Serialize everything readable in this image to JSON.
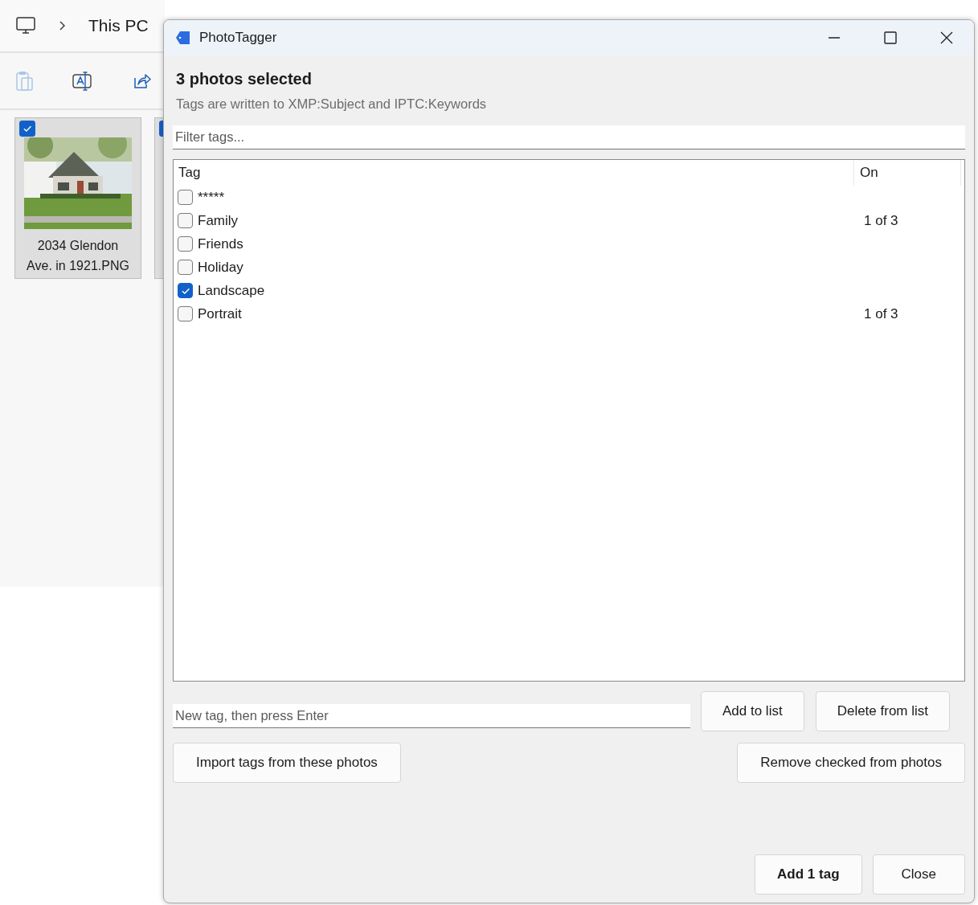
{
  "explorer": {
    "breadcrumb": [
      {
        "label": "This PC"
      }
    ],
    "files": [
      {
        "name": "2034 Glendon Ave. in 1921.PNG",
        "selected": true,
        "kind": "picture"
      },
      {
        "selected": true
      }
    ]
  },
  "dialog": {
    "title": "PhotoTagger",
    "heading": "3 photos selected",
    "subtitle": "Tags are written to XMP:Subject and IPTC:Keywords",
    "filter": {
      "placeholder": "Filter tags..."
    },
    "tag_list": {
      "columns": [
        "Tag",
        "On"
      ],
      "rows": [
        {
          "tag": "*****",
          "checked": false
        },
        {
          "tag": "Family",
          "checked": false,
          "on": "1 of 3"
        },
        {
          "tag": "Friends",
          "checked": false
        },
        {
          "tag": "Holiday",
          "checked": false
        },
        {
          "tag": "Landscape",
          "checked": true
        },
        {
          "tag": "Portrait",
          "checked": false,
          "on": "1 of 3"
        }
      ]
    },
    "new_tag": {
      "placeholder": "New tag, then press Enter"
    },
    "list_buttons": [
      {
        "label": "Add to list"
      },
      {
        "label": "Delete from list"
      }
    ],
    "action_buttons": [
      {
        "label": "Import tags from these photos"
      },
      {
        "label": "Remove checked from photos"
      }
    ],
    "footer_buttons": [
      {
        "label": "Add 1 tag",
        "default": true
      },
      {
        "label": "Close",
        "default": false
      }
    ]
  }
}
